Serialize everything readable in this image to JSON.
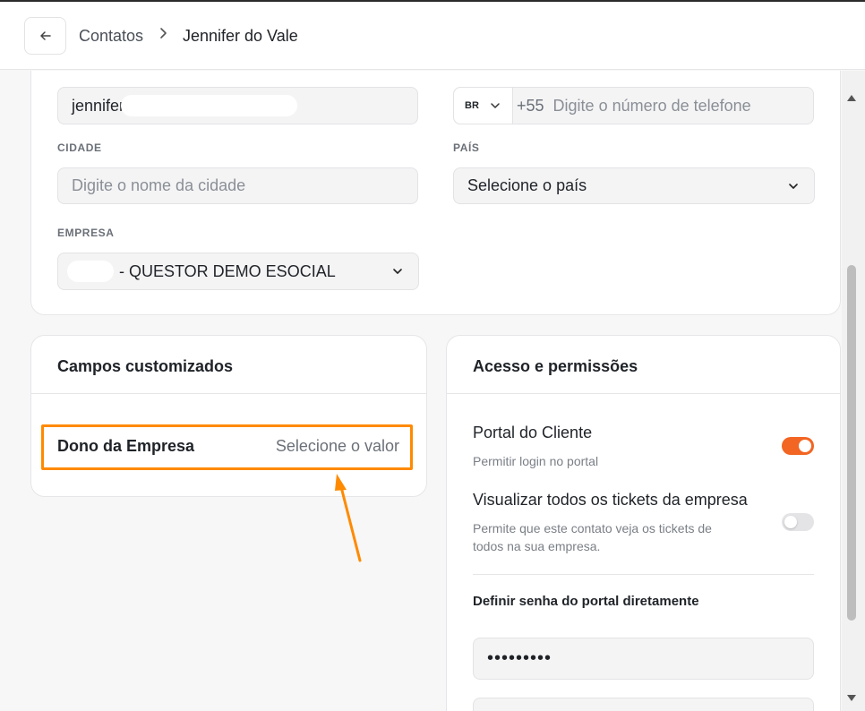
{
  "breadcrumb": {
    "parent": "Contatos",
    "current": "Jennifer do Vale"
  },
  "contact_form": {
    "email_value": "jennifer",
    "phone": {
      "country_code": "BR",
      "dial_prefix": "+55",
      "placeholder": "Digite o número de telefone"
    },
    "city": {
      "label": "CIDADE",
      "placeholder": "Digite o nome da cidade"
    },
    "country": {
      "label": "PAÍS",
      "value": "Selecione o país"
    },
    "company": {
      "label": "EMPRESA",
      "value": "- QUESTOR DEMO ESOCIAL"
    }
  },
  "custom_fields": {
    "title": "Campos customizados",
    "items": [
      {
        "label": "Dono da Empresa",
        "value": "Selecione o valor"
      }
    ]
  },
  "access": {
    "title": "Acesso e permissões",
    "portal": {
      "label": "Portal do Cliente",
      "description": "Permitir login no portal",
      "enabled": true
    },
    "view_all": {
      "label": "Visualizar todos os tickets da empresa",
      "description_line1": "Permite que este contato veja os tickets de",
      "description_line2": "todos na sua empresa.",
      "enabled": false
    },
    "password": {
      "label": "Definir senha do portal diretamente",
      "value": "•••••••••"
    }
  },
  "colors": {
    "accent": "#f26522",
    "annotation": "#ff8a00",
    "toggle_off": "#e4e4e7"
  }
}
